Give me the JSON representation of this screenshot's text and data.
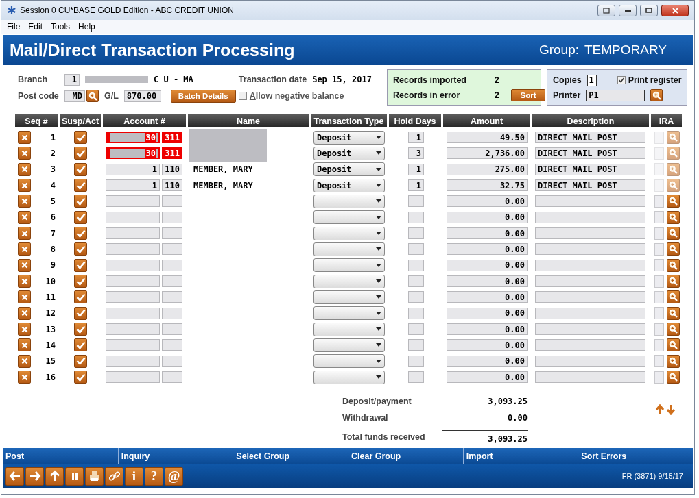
{
  "window": {
    "title": "Session 0 CU*BASE GOLD Edition - ABC CREDIT UNION"
  },
  "menu": [
    "File",
    "Edit",
    "Tools",
    "Help"
  ],
  "header": {
    "title": "Mail/Direct Transaction Processing",
    "group_label": "Group:",
    "group": "TEMPORARY"
  },
  "form": {
    "branch_label": "Branch",
    "branch": "1",
    "branch_name": "C U - MA",
    "date_label": "Transaction date",
    "date": "Sep 15, 2017",
    "post_code_label": "Post code",
    "post_code": "MD",
    "gl_label": "G/L",
    "gl": "870.00",
    "batch_button": "Batch Details",
    "allow_negative": {
      "label": "Allow negative balance",
      "checked": false
    }
  },
  "records": {
    "imported_label": "Records imported",
    "imported": "2",
    "errors_label": "Records in error",
    "errors": "2",
    "sort_button": "Sort"
  },
  "print": {
    "copies_label": "Copies",
    "copies": "1",
    "register": {
      "label": "Print register",
      "checked": true
    },
    "printer_label": "Printer",
    "printer": "P1"
  },
  "table": {
    "columns": [
      "Seq #",
      "Susp/Act",
      "Account #",
      "Name",
      "Transaction Type",
      "Hold Days",
      "Amount",
      "Description",
      "IRA"
    ],
    "rows": [
      {
        "seq": "1",
        "checked": true,
        "error": true,
        "account": "30",
        "suffix": "311",
        "name_redacted": true,
        "type": "Deposit",
        "hold_days": "1",
        "amount": "49.50",
        "description": "DIRECT MAIL POST",
        "ira_disabled": true
      },
      {
        "seq": "2",
        "checked": true,
        "error": true,
        "account": "30",
        "suffix": "311",
        "name_redacted": true,
        "type": "Deposit",
        "hold_days": "3",
        "amount": "2,736.00",
        "description": "DIRECT MAIL POST",
        "ira_disabled": true
      },
      {
        "seq": "3",
        "checked": true,
        "error": false,
        "account": "1",
        "suffix": "110",
        "name": "MEMBER, MARY",
        "type": "Deposit",
        "hold_days": "1",
        "amount": "275.00",
        "description": "DIRECT MAIL POST",
        "ira_disabled": true
      },
      {
        "seq": "4",
        "checked": true,
        "error": false,
        "account": "1",
        "suffix": "110",
        "name": "MEMBER, MARY",
        "type": "Deposit",
        "hold_days": "1",
        "amount": "32.75",
        "description": "DIRECT MAIL POST",
        "ira_disabled": true
      },
      {
        "seq": "5",
        "checked": true,
        "error": false,
        "amount": "0.00",
        "ira_disabled": false
      },
      {
        "seq": "6",
        "checked": true,
        "error": false,
        "amount": "0.00",
        "ira_disabled": false
      },
      {
        "seq": "7",
        "checked": true,
        "error": false,
        "amount": "0.00",
        "ira_disabled": false
      },
      {
        "seq": "8",
        "checked": true,
        "error": false,
        "amount": "0.00",
        "ira_disabled": false
      },
      {
        "seq": "9",
        "checked": true,
        "error": false,
        "amount": "0.00",
        "ira_disabled": false
      },
      {
        "seq": "10",
        "checked": true,
        "error": false,
        "amount": "0.00",
        "ira_disabled": false
      },
      {
        "seq": "11",
        "checked": true,
        "error": false,
        "amount": "0.00",
        "ira_disabled": false
      },
      {
        "seq": "12",
        "checked": true,
        "error": false,
        "amount": "0.00",
        "ira_disabled": false
      },
      {
        "seq": "13",
        "checked": true,
        "error": false,
        "amount": "0.00",
        "ira_disabled": false
      },
      {
        "seq": "14",
        "checked": true,
        "error": false,
        "amount": "0.00",
        "ira_disabled": false
      },
      {
        "seq": "15",
        "checked": true,
        "error": false,
        "amount": "0.00",
        "ira_disabled": false
      },
      {
        "seq": "16",
        "checked": true,
        "error": false,
        "amount": "0.00",
        "ira_disabled": false
      }
    ]
  },
  "totals": {
    "deposit_label": "Deposit/payment",
    "deposit": "3,093.25",
    "withdrawal_label": "Withdrawal",
    "withdrawal": "0.00",
    "total_label": "Total funds received",
    "total": "3,093.25"
  },
  "functions": [
    "Post",
    "Inquiry",
    "Select Group",
    "Clear Group",
    "Import",
    "Sort Errors"
  ],
  "toolbar": [
    {
      "kind": "back"
    },
    {
      "kind": "forward"
    },
    {
      "kind": "up"
    },
    {
      "kind": "pause"
    },
    {
      "kind": "print"
    },
    {
      "kind": "link"
    },
    {
      "kind": "text",
      "label": "i"
    },
    {
      "kind": "text",
      "label": "?"
    },
    {
      "kind": "text",
      "label": "@"
    }
  ],
  "status": "FR (3871) 9/15/17"
}
